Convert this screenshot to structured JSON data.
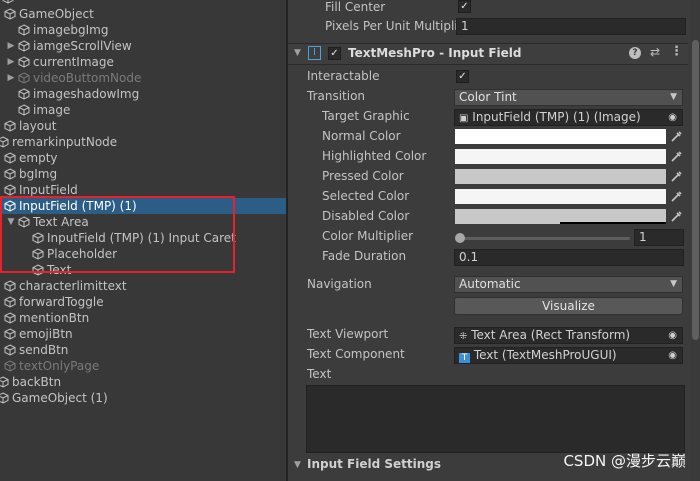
{
  "hierarchy": {
    "items": [
      {
        "label": "GameObject",
        "dim": false
      },
      {
        "label": "imagebgImg",
        "dim": false
      },
      {
        "label": "iamgeScrollView",
        "dim": false
      },
      {
        "label": "currentImage",
        "dim": false
      },
      {
        "label": "videoButtomNode",
        "dim": true
      },
      {
        "label": "imageshadowImg",
        "dim": false
      },
      {
        "label": "image",
        "dim": false
      },
      {
        "label": "layout",
        "dim": false
      },
      {
        "label": "remarkinputNode",
        "dim": false
      },
      {
        "label": "empty",
        "dim": false
      },
      {
        "label": "bgImg",
        "dim": false
      },
      {
        "label": "InputField",
        "dim": false
      },
      {
        "label": "InputField (TMP) (1)",
        "dim": false
      },
      {
        "label": "Text Area",
        "dim": false
      },
      {
        "label": "InputField (TMP) (1) Input Caret",
        "dim": false
      },
      {
        "label": "Placeholder",
        "dim": false
      },
      {
        "label": "Text",
        "dim": false
      },
      {
        "label": "characterlimittext",
        "dim": false
      },
      {
        "label": "forwardToggle",
        "dim": false
      },
      {
        "label": "mentionBtn",
        "dim": false
      },
      {
        "label": "emojiBtn",
        "dim": false
      },
      {
        "label": "sendBtn",
        "dim": false
      },
      {
        "label": "textOnlyPage",
        "dim": true
      },
      {
        "label": "backBtn",
        "dim": false
      },
      {
        "label": "GameObject (1)",
        "dim": false
      }
    ]
  },
  "inspector": {
    "fill_center_label": "Fill Center",
    "ppu_label": "Pixels Per Unit Multiplie",
    "ppu_value": "1",
    "component_title": "TextMeshPro - Input Field",
    "interactable_label": "Interactable",
    "transition_label": "Transition",
    "transition_value": "Color Tint",
    "target_graphic_label": "Target Graphic",
    "target_graphic_value": "InputField (TMP) (1) (Image)",
    "normal_color_label": "Normal Color",
    "highlighted_color_label": "Highlighted Color",
    "pressed_color_label": "Pressed Color",
    "selected_color_label": "Selected Color",
    "disabled_color_label": "Disabled Color",
    "color_multiplier_label": "Color Multiplier",
    "color_multiplier_value": "1",
    "fade_duration_label": "Fade Duration",
    "fade_duration_value": "0.1",
    "navigation_label": "Navigation",
    "navigation_value": "Automatic",
    "visualize_label": "Visualize",
    "text_viewport_label": "Text Viewport",
    "text_viewport_value": "Text Area (Rect Transform)",
    "text_component_label": "Text Component",
    "text_component_value": "Text (TextMeshProUGUI)",
    "text_label": "Text",
    "input_field_settings_label": "Input Field Settings"
  },
  "colors": {
    "normal": "#ffffff",
    "highlighted": "#f5f5f5",
    "pressed": "#c8c8c8",
    "selected": "#f5f5f5",
    "disabled": "#c8c8c8",
    "selection": "#2c5d87",
    "highlight_box": "#e8212b"
  },
  "watermark": "CSDN @漫步云巅"
}
